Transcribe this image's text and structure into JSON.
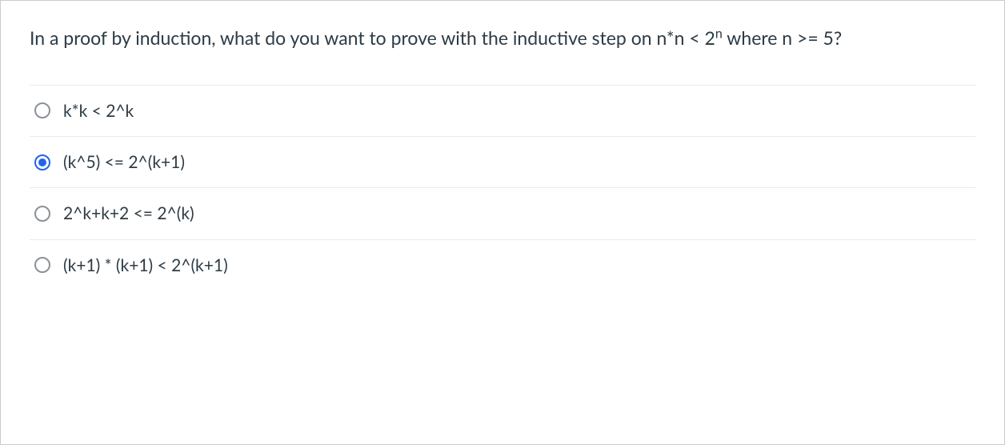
{
  "question": {
    "prefix": "In a proof by induction, what do you want to prove with the inductive step on n*n < 2",
    "sup": "n",
    "suffix": " where n >= 5?"
  },
  "options": [
    {
      "label": "k*k < 2^k",
      "selected": false
    },
    {
      "label": "(k^5) <= 2^(k+1)",
      "selected": true
    },
    {
      "label": "2^k+k+2 <= 2^(k)",
      "selected": false
    },
    {
      "label": "(k+1) * (k+1) < 2^(k+1)",
      "selected": false
    }
  ]
}
